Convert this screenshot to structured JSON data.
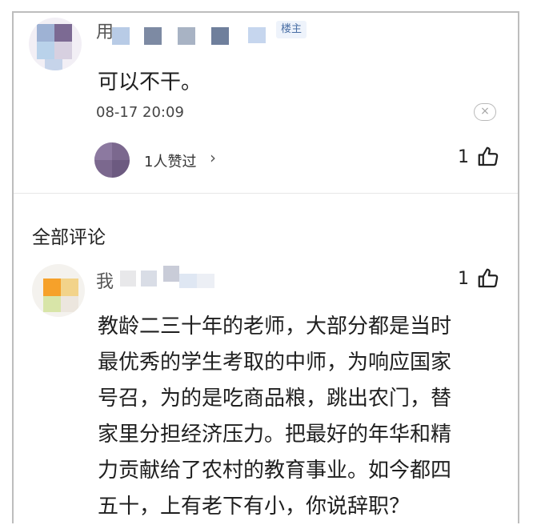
{
  "reply": {
    "username_visible": "用",
    "badge": "楼主",
    "text": "可以不干。",
    "timestamp": "08-17 20:09",
    "close_symbol": "×",
    "likes_summary": "1人赞过",
    "likes_chevron": "›",
    "like_count": "1"
  },
  "section_title": "全部评论",
  "comment": {
    "username_visible": "我",
    "like_count": "1",
    "lines": [
      "教龄二三十年的老师，大部分都是当时",
      "最优秀的学生考取的中师，为响应国家",
      "号召，为的是吃商品粮，跳出农门，替",
      "家里分担经济压力。把最好的年华和精",
      "力贡献给了农村的教育事业。如今都四",
      "五十，上有老下有小，你说辞职？"
    ]
  },
  "colors": {
    "badge_text": "#4a6fa5",
    "divider": "#e7e7e7",
    "text": "#1f1f1f"
  }
}
